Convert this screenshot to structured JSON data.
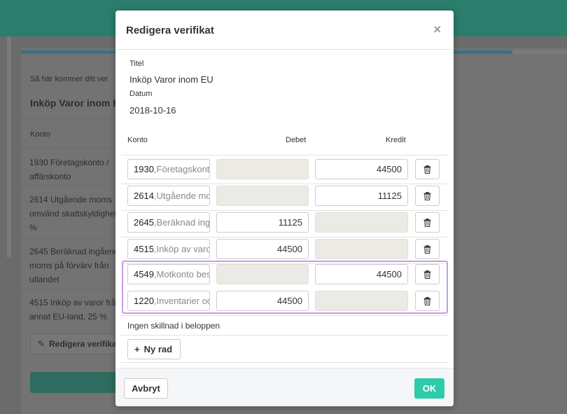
{
  "background": {
    "intro_text": "Så här kommer ditt ver",
    "title": "Inköp Varor inom E",
    "konto_header": "Konto",
    "rows": [
      [
        "1930 Företagskonto /",
        "affärskonto"
      ],
      [
        "2614 Utgående moms",
        "omvänd skattskyldighet",
        "%"
      ],
      [
        "2645 Beräknad ingående",
        "moms på förvärv från",
        "utlandet"
      ],
      [
        "4515 Inköp av varor från",
        "annat EU-land, 25 %"
      ]
    ],
    "edit_button": "Redigera verifikat"
  },
  "modal": {
    "title": "Redigera verifikat",
    "close": "×",
    "titel_label": "Titel",
    "titel_value": "Inköp Varor inom EU",
    "datum_label": "Datum",
    "datum_value": "2018-10-16",
    "columns": {
      "konto": "Konto",
      "debet": "Debet",
      "kredit": "Kredit"
    },
    "rows": [
      {
        "account": "1930",
        "desc": ",Företagskonto",
        "debet": "",
        "kredit": "44500"
      },
      {
        "account": "2614",
        "desc": ",Utgående mo",
        "debet": "",
        "kredit": "11125"
      },
      {
        "account": "2645",
        "desc": ",Beräknad ing",
        "debet": "11125",
        "kredit": ""
      },
      {
        "account": "4515",
        "desc": ",Inköp av varo",
        "debet": "44500",
        "kredit": ""
      },
      {
        "account": "4549",
        "desc": ",Motkonto bes",
        "debet": "",
        "kredit": "44500"
      },
      {
        "account": "1220",
        "desc": ",Inventarier oc",
        "debet": "44500",
        "kredit": ""
      }
    ],
    "difference_text": "Ingen skillnad i beloppen",
    "add_row": "Ny rad",
    "add_icon": "+",
    "cancel": "Avbryt",
    "ok": "OK",
    "highlight_color": "#c89bea",
    "ok_color": "#2ecbaa"
  }
}
